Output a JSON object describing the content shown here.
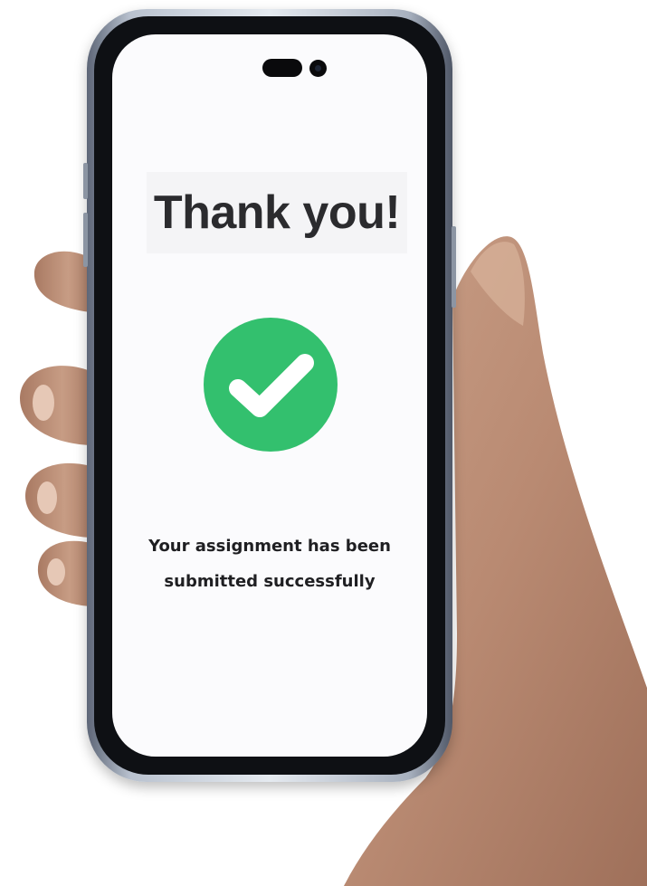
{
  "screen": {
    "title": "Thank you!",
    "message": "Your assignment has been submitted successfully"
  },
  "icons": {
    "success": "check-circle-icon"
  },
  "colors": {
    "success_green": "#33c06e",
    "check_white": "#ffffff",
    "title_text": "#2b2b2e",
    "body_text": "#1f1f22"
  }
}
